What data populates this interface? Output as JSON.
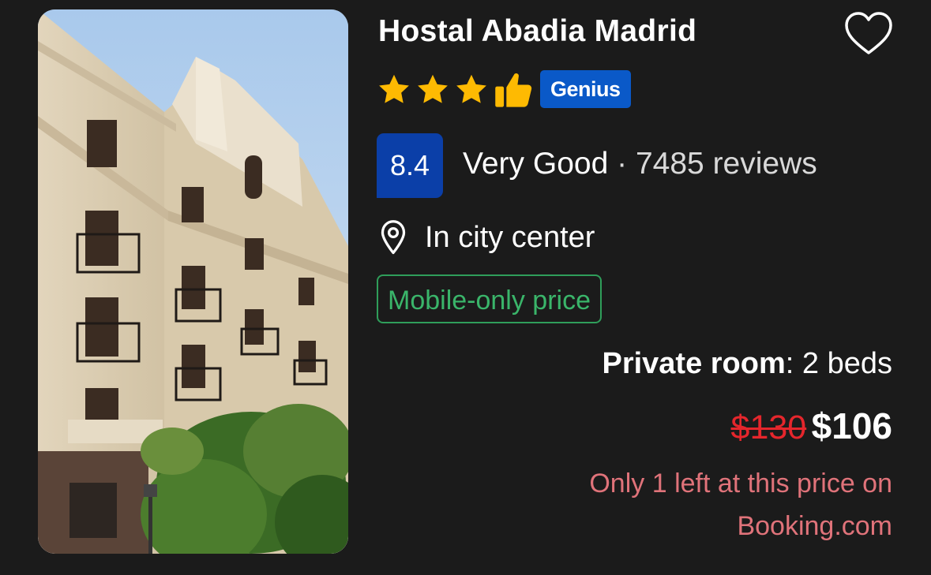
{
  "hotel": {
    "name": "Hostal Abadia Madrid",
    "star_count": 3,
    "badge": "Genius",
    "favorite_icon": "heart-outline-icon",
    "star_icon": "star-icon",
    "preferred_icon": "thumbs-up-icon"
  },
  "rating": {
    "score": "8.4",
    "label": "Very Good",
    "separator": "·",
    "reviews": "7485 reviews"
  },
  "location": {
    "icon": "map-pin-icon",
    "text": "In city center"
  },
  "deal_badge": "Mobile-only price",
  "room": {
    "type": "Private room",
    "separator": ":",
    "beds": " 2 beds"
  },
  "price": {
    "original": "$130",
    "current": "$106"
  },
  "scarcity": {
    "line1": "Only 1 left at this price on",
    "line2": "Booking.com"
  },
  "colors": {
    "background": "#1b1b1b",
    "star": "#feba02",
    "genius_blue": "#0a59c8",
    "score_blue": "#0b3fa8",
    "deal_green": "#2f9e5a",
    "strike_red": "#e5262c",
    "scarcity_red": "#e0737a"
  }
}
